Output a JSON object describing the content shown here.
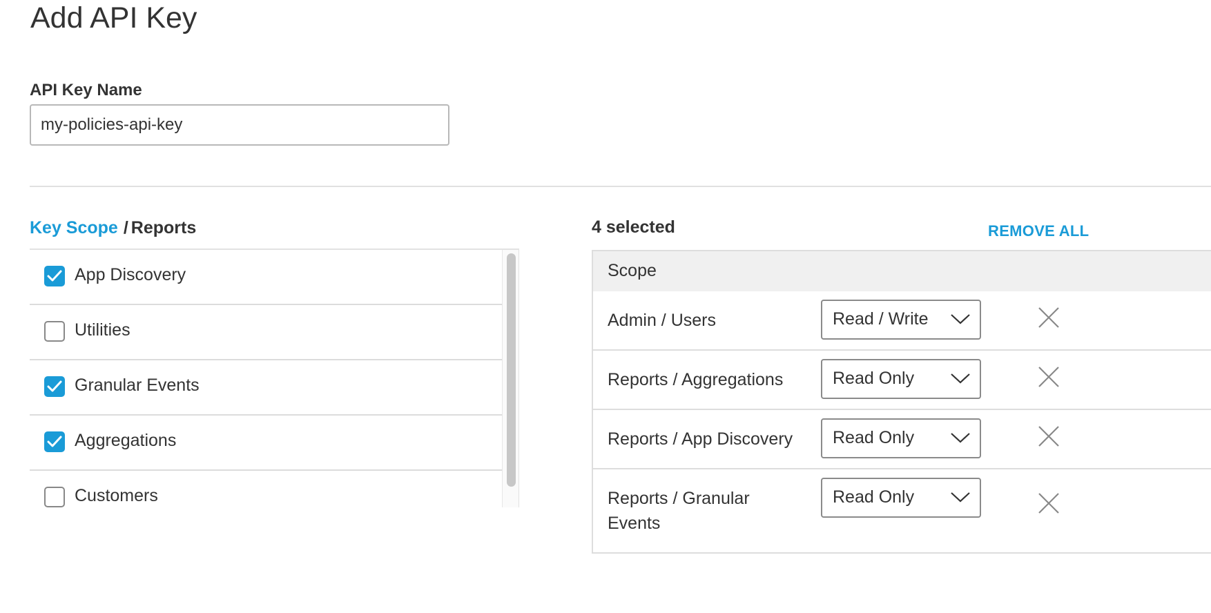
{
  "page": {
    "title": "Add API Key"
  },
  "name_field": {
    "label": "API Key Name",
    "value": "my-policies-api-key"
  },
  "scope": {
    "breadcrumb_link": "Key Scope",
    "breadcrumb_separator": "/",
    "breadcrumb_current": "Reports",
    "items": [
      {
        "label": "App Discovery",
        "checked": true
      },
      {
        "label": "Utilities",
        "checked": false
      },
      {
        "label": "Granular Events",
        "checked": true
      },
      {
        "label": "Aggregations",
        "checked": true
      },
      {
        "label": "Customers",
        "checked": false
      }
    ]
  },
  "selected": {
    "count_text": "4 selected",
    "remove_all_label": "REMOVE ALL",
    "column_header": "Scope",
    "rows": [
      {
        "name": "Admin / Users",
        "permission": "Read / Write"
      },
      {
        "name": "Reports / Aggregations",
        "permission": "Read Only"
      },
      {
        "name": "Reports / App Discovery",
        "permission": "Read Only"
      },
      {
        "name": "Reports / Granular Events",
        "permission": "Read Only"
      }
    ]
  },
  "colors": {
    "accent": "#1a9bd7",
    "text": "#333333",
    "header_bg": "#f0f0f0",
    "divider": "#e0e0e0"
  },
  "icons": {
    "checkbox_checked": "check-icon",
    "dropdown": "chevron-down-icon",
    "remove": "close-icon"
  }
}
